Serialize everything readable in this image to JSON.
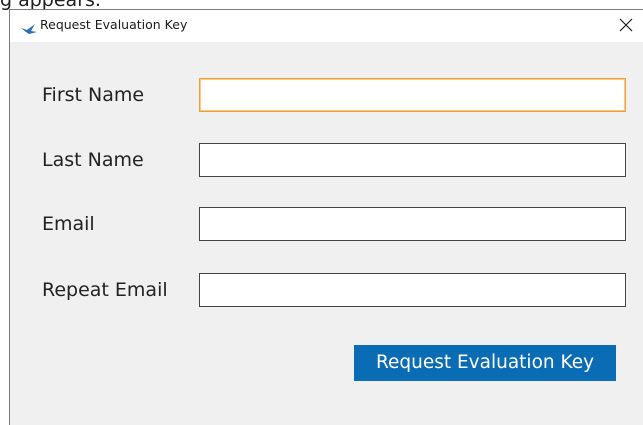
{
  "background_caption": "g appears.",
  "window": {
    "title": "Request Evaluation Key",
    "close_label": "Close"
  },
  "form": {
    "first_name": {
      "label": "First Name",
      "value": "",
      "focused": true
    },
    "last_name": {
      "label": "Last Name",
      "value": ""
    },
    "email": {
      "label": "Email",
      "value": ""
    },
    "repeat_email": {
      "label": "Repeat Email",
      "value": ""
    }
  },
  "actions": {
    "submit_label": "Request Evaluation Key"
  },
  "colors": {
    "accent": "#0a6cb5",
    "focus_border": "#f0a030",
    "dialog_background": "#f0f0f0"
  },
  "icons": {
    "app": "bird-logo-icon",
    "close": "close-icon"
  }
}
